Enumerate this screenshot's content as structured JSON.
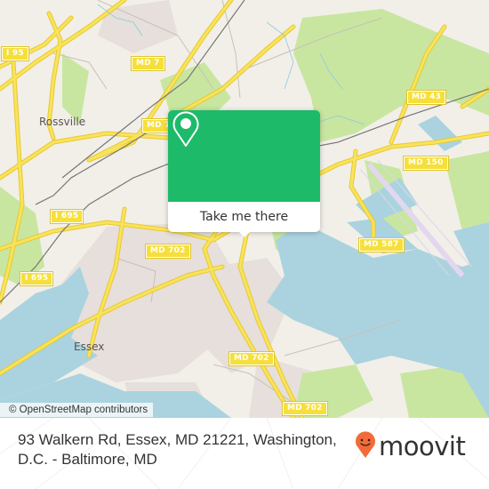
{
  "map": {
    "places": [
      {
        "name": "Rossville"
      },
      {
        "name": "Essex"
      }
    ],
    "road_shields": [
      {
        "label": "I 95"
      },
      {
        "label": "MD 7"
      },
      {
        "label": "MD 7"
      },
      {
        "label": "MD 43"
      },
      {
        "label": "MD 150"
      },
      {
        "label": "I 695"
      },
      {
        "label": "I 695"
      },
      {
        "label": "MD 702"
      },
      {
        "label": "MD 587"
      },
      {
        "label": "MD 702"
      },
      {
        "label": "MD 702"
      }
    ],
    "attribution": "© OpenStreetMap contributors",
    "colors": {
      "land": "#f2efe9",
      "water": "#aad3df",
      "park": "#c8e6a0",
      "residential": "#e6dfdb",
      "road": "#f6df3a",
      "rail": "#777777",
      "runway": "#e3d7f0"
    }
  },
  "popup": {
    "icon": "location-pin-icon",
    "cta_label": "Take me there",
    "accent": "#1dba6a"
  },
  "footer": {
    "address": "93 Walkern Rd, Essex, MD 21221, Washington, D.C. - Baltimore, MD",
    "brand": "moovit",
    "brand_icon": "moovit-pin-smiley-icon",
    "brand_color": "#f26b3a"
  }
}
